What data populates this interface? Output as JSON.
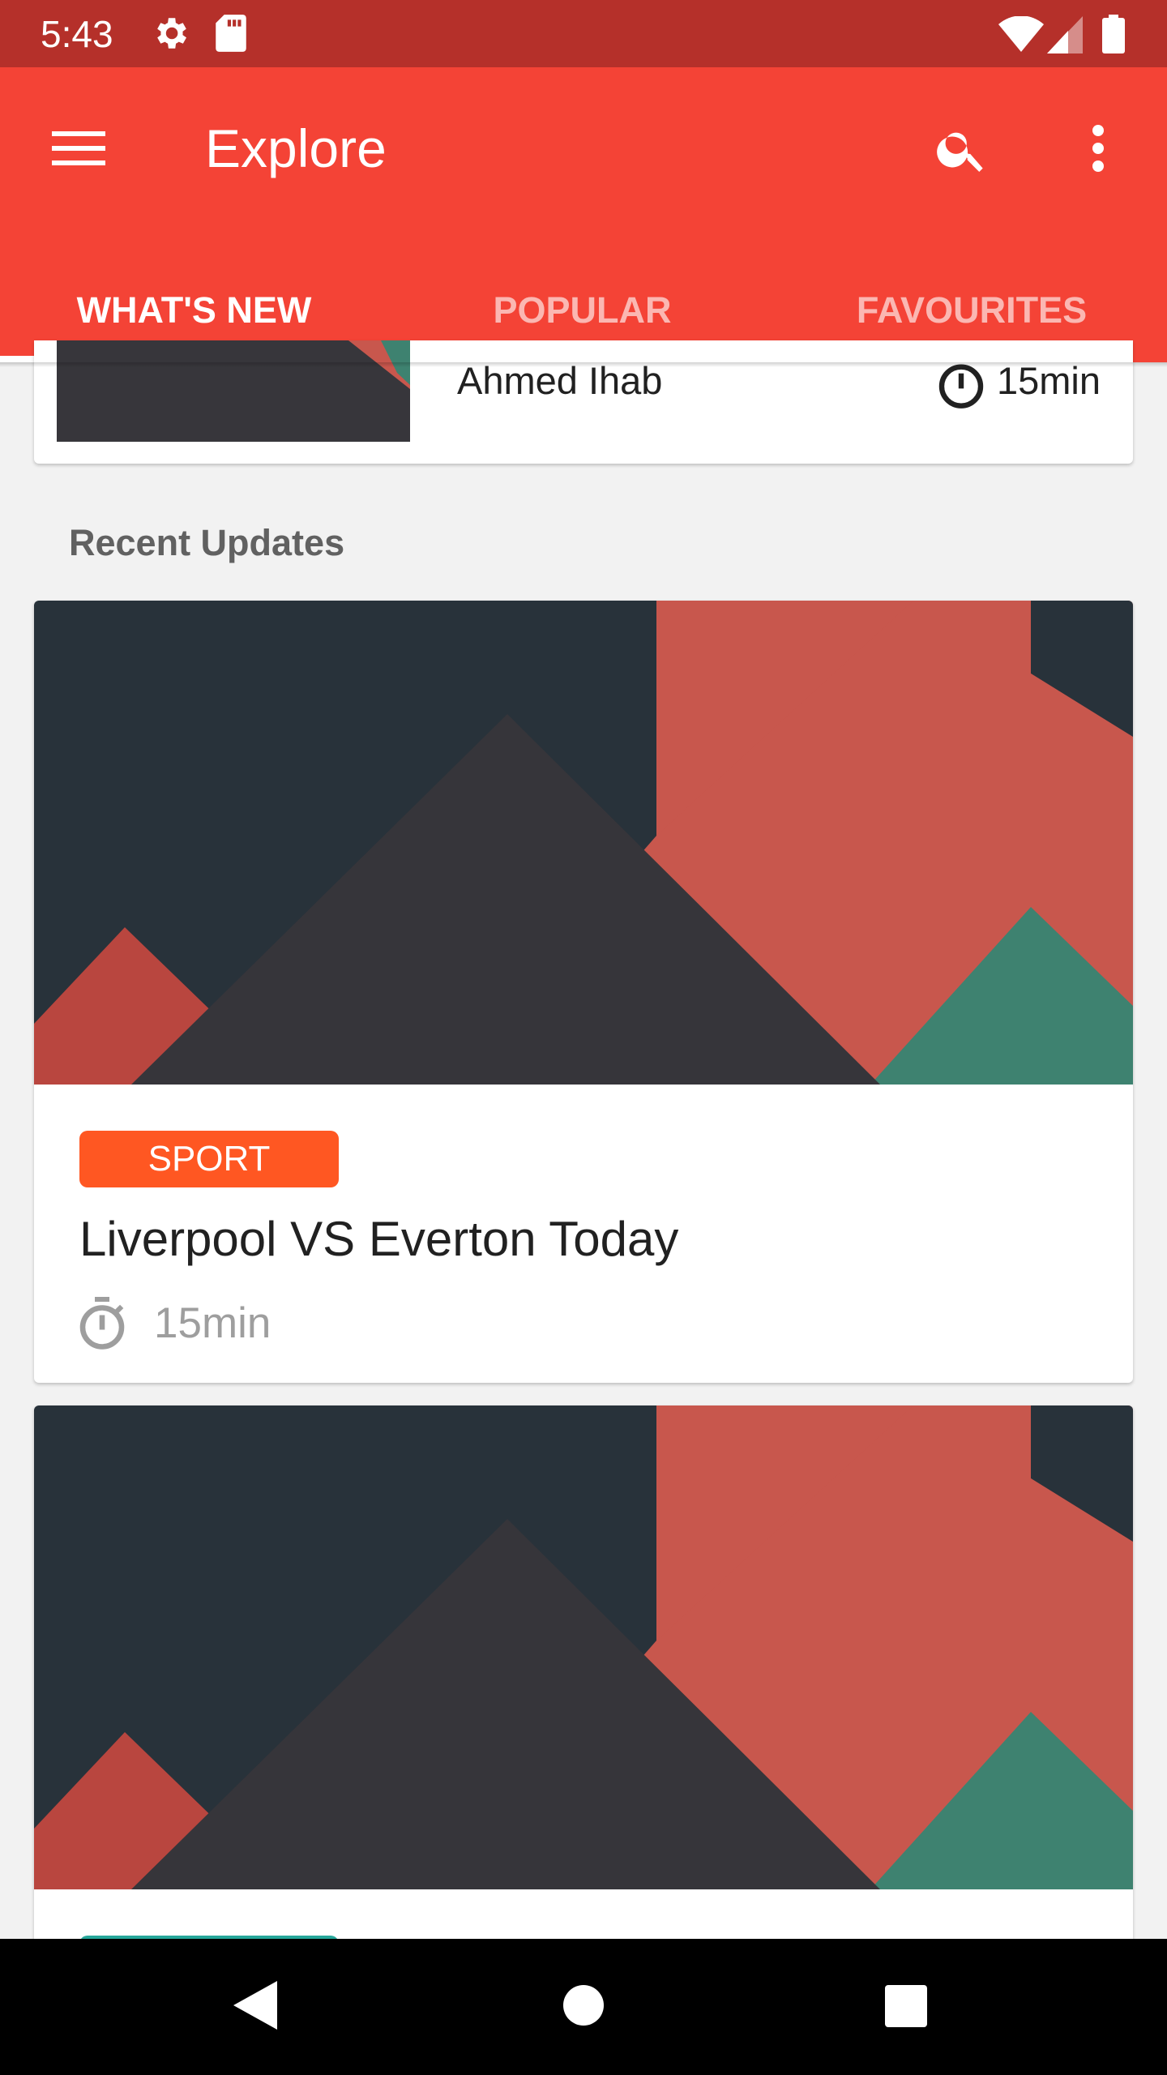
{
  "status_bar": {
    "time": "5:43",
    "left_icons": [
      "gear-icon",
      "sd-card-icon"
    ],
    "right_icons": [
      "wifi-icon",
      "signal-icon",
      "battery-icon"
    ]
  },
  "app_bar": {
    "title": "Explore",
    "color": "#f44336",
    "menu_icon": "menu-icon",
    "actions": [
      "search-icon",
      "more-vert-icon"
    ]
  },
  "tabs": [
    {
      "label": "WHAT'S NEW",
      "active": true
    },
    {
      "label": "POPULAR",
      "active": false
    },
    {
      "label": "FAVOURITES",
      "active": false
    }
  ],
  "top_card": {
    "author": "Ahmed Ihab",
    "duration": "15min"
  },
  "section": {
    "title": "Recent Updates"
  },
  "cards": [
    {
      "tag": "SPORT",
      "tag_color": "#ff5722",
      "title": "Liverpool VS Everton Today",
      "duration": "15min"
    },
    {
      "tag_color": "#26a69a"
    }
  ],
  "nav_bar": {
    "buttons": [
      "back-button",
      "home-button",
      "recents-button"
    ]
  }
}
